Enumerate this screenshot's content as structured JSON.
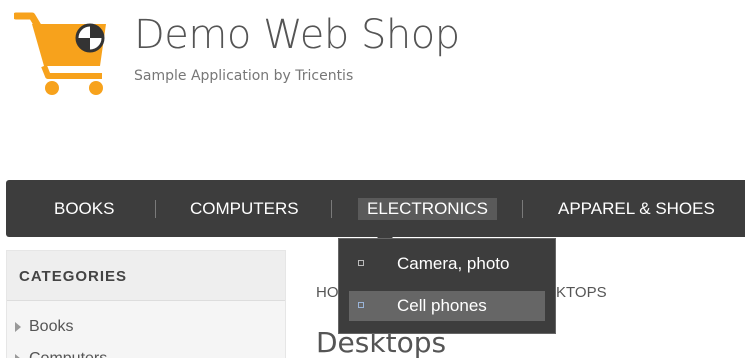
{
  "header": {
    "title": "Demo Web Shop",
    "subtitle": "Sample Application by Tricentis",
    "logo_icon": "shopping-cart-icon",
    "colors": {
      "cart": "#f7a21c",
      "badge": "#333333"
    }
  },
  "top_menu": {
    "items": [
      {
        "label": "BOOKS"
      },
      {
        "label": "COMPUTERS"
      },
      {
        "label": "ELECTRONICS"
      },
      {
        "label": "APPAREL & SHOES"
      }
    ],
    "active": "ELECTRONICS",
    "dropdown": [
      {
        "label": "Camera, photo"
      },
      {
        "label": "Cell phones"
      }
    ],
    "colors": {
      "bar": "#3d3d3d",
      "active": "#5a5a5a",
      "highlight": "#666666"
    }
  },
  "sidebar": {
    "title": "CATEGORIES",
    "items": [
      {
        "label": "Books"
      },
      {
        "label": "Computers"
      }
    ]
  },
  "main": {
    "breadcrumb_start": "HO",
    "breadcrumb_end": "KTOPS",
    "page_title": "Desktops"
  }
}
